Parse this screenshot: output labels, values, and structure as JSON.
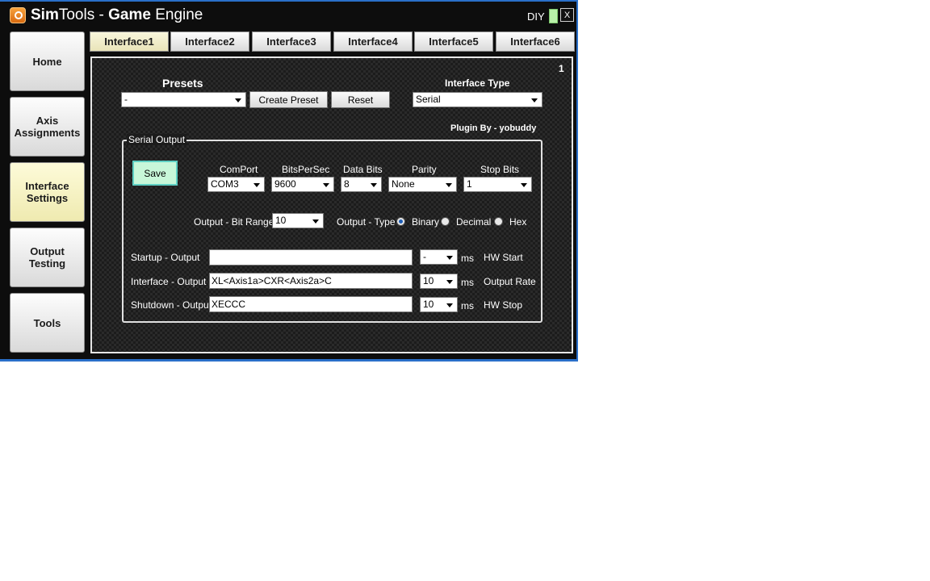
{
  "window": {
    "title_part1": "Sim",
    "title_part2": "Tools",
    "title_sep": " - ",
    "title_part3": "Game",
    "title_part4": " Engine",
    "diy_label": "DIY",
    "close_label": "X"
  },
  "sidebar": {
    "items": [
      {
        "label": "Home"
      },
      {
        "label": "Axis\nAssignments"
      },
      {
        "label": "Interface\nSettings"
      },
      {
        "label": "Output\nTesting"
      },
      {
        "label": "Tools"
      }
    ],
    "active_index": 2
  },
  "tabs": [
    {
      "label": "Interface1"
    },
    {
      "label": "Interface2"
    },
    {
      "label": "Interface3"
    },
    {
      "label": "Interface4"
    },
    {
      "label": "Interface5"
    },
    {
      "label": "Interface6"
    }
  ],
  "main": {
    "page_number": "1",
    "presets_heading": "Presets",
    "preset_value": "-",
    "create_preset_label": "Create Preset",
    "reset_label": "Reset",
    "interface_type_heading": "Interface Type",
    "interface_type_value": "Serial",
    "plugin_by": "Plugin By - yobuddy"
  },
  "serial": {
    "group_title": "Serial Output",
    "save_label": "Save",
    "comport_label": "ComPort",
    "comport_value": "COM3",
    "bps_label": "BitsPerSec",
    "bps_value": "9600",
    "databits_label": "Data Bits",
    "databits_value": "8",
    "parity_label": "Parity",
    "parity_value": "None",
    "stopbits_label": "Stop Bits",
    "stopbits_value": "1",
    "bitrange_label": "Output - Bit Range",
    "bitrange_value": "10",
    "output_type_label": "Output - Type",
    "output_types": [
      "Binary",
      "Decimal",
      "Hex"
    ],
    "output_type_selected": "Binary",
    "startup_label": "Startup - Output",
    "startup_value": "",
    "startup_ms_value": "-",
    "interface_label": "Interface - Output",
    "interface_value": "XL<Axis1a>CXR<Axis2a>C",
    "interface_ms_value": "10",
    "shutdown_label": "Shutdown - Output",
    "shutdown_value": "XECCC",
    "shutdown_ms_value": "10",
    "ms_label": "ms",
    "hw_start_label": "HW Start",
    "output_rate_label": "Output Rate",
    "hw_stop_label": "HW Stop"
  }
}
